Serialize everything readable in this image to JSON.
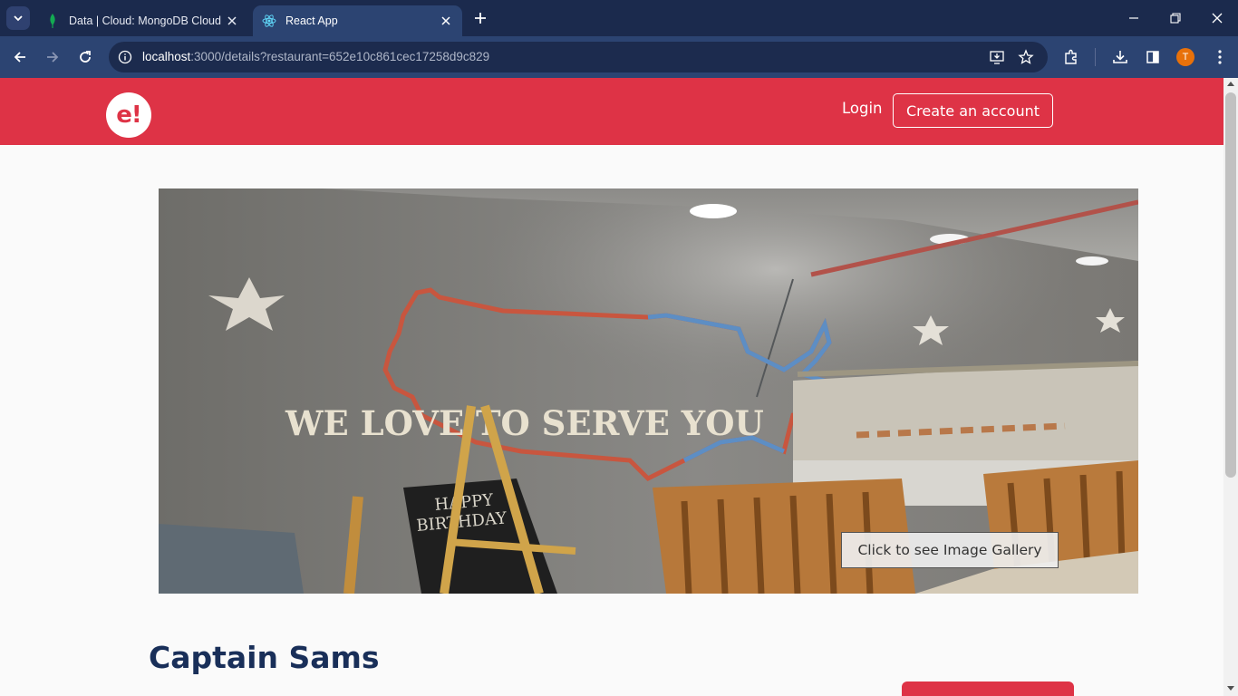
{
  "browser": {
    "tabs": [
      {
        "title": "Data | Cloud: MongoDB Cloud",
        "icon": "mongodb-leaf-icon",
        "active": false
      },
      {
        "title": "React App",
        "icon": "react-icon",
        "active": true
      }
    ],
    "url_host": "localhost",
    "url_rest": ":3000/details?restaurant=652e10c861cec17258d9c829",
    "profile_initial": "T",
    "colors": {
      "tabbar": "#1b2a4d",
      "toolbar": "#2c4472",
      "omnibox": "#1c2b4e",
      "profile": "#e8710a"
    }
  },
  "header": {
    "logo_text": "e!",
    "login_label": "Login",
    "create_account_label": "Create an account",
    "color": "#de3346"
  },
  "hero": {
    "wall_text": "WE LOVE TO SERVE YOU",
    "board_text_1": "HAPPY",
    "board_text_2": "BIRTHDAY",
    "gallery_button_label": "Click to see Image Gallery"
  },
  "restaurant": {
    "name": "Captain Sams",
    "name_color": "#192f59"
  }
}
